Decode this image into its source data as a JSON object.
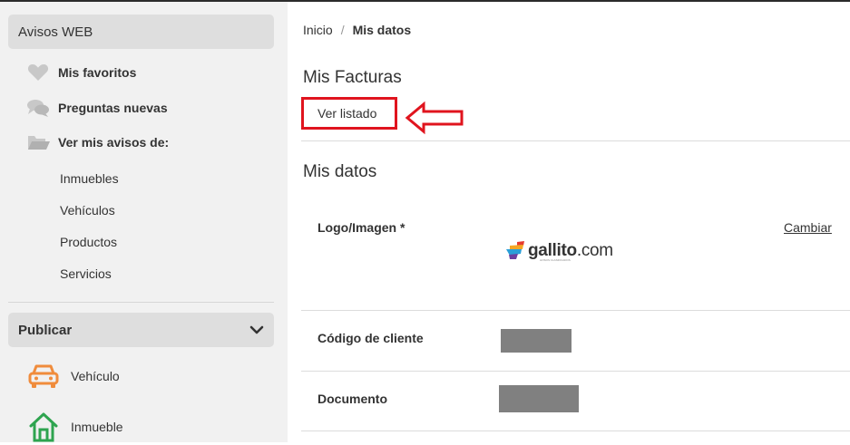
{
  "sidebar": {
    "avisos_header": "Avisos WEB",
    "items": [
      {
        "label": "Mis favoritos",
        "icon": "heart-icon"
      },
      {
        "label": "Preguntas nuevas",
        "icon": "chat-bubbles-icon"
      },
      {
        "label": "Ver mis avisos de:",
        "icon": "folder-open-icon"
      }
    ],
    "sub_items": [
      "Inmuebles",
      "Vehículos",
      "Productos",
      "Servicios"
    ],
    "publicar_header": "Publicar",
    "publicar_items": [
      {
        "label": "Vehículo",
        "icon": "car-icon"
      },
      {
        "label": "Inmueble",
        "icon": "house-icon"
      }
    ]
  },
  "breadcrumb": {
    "home": "Inicio",
    "separator": "/",
    "current": "Mis datos"
  },
  "facturas": {
    "title": "Mis Facturas",
    "link": "Ver listado"
  },
  "datos": {
    "title": "Mis datos",
    "logo_label": "Logo/Imagen *",
    "cambiar": "Cambiar",
    "logo_brand_bold": "gallito",
    "logo_brand_suffix": ".com",
    "logo_tagline": "AVISOS CLASIFICADOS",
    "codigo_label": "Código de cliente",
    "documento_label": "Documento"
  },
  "colors": {
    "highlight_red": "#e0141e",
    "car_icon": "#f08c3c",
    "house_icon": "#2ea44f",
    "sidebar_bg": "#f1f1f1",
    "header_bg": "#dedede",
    "redaction": "#808080"
  }
}
